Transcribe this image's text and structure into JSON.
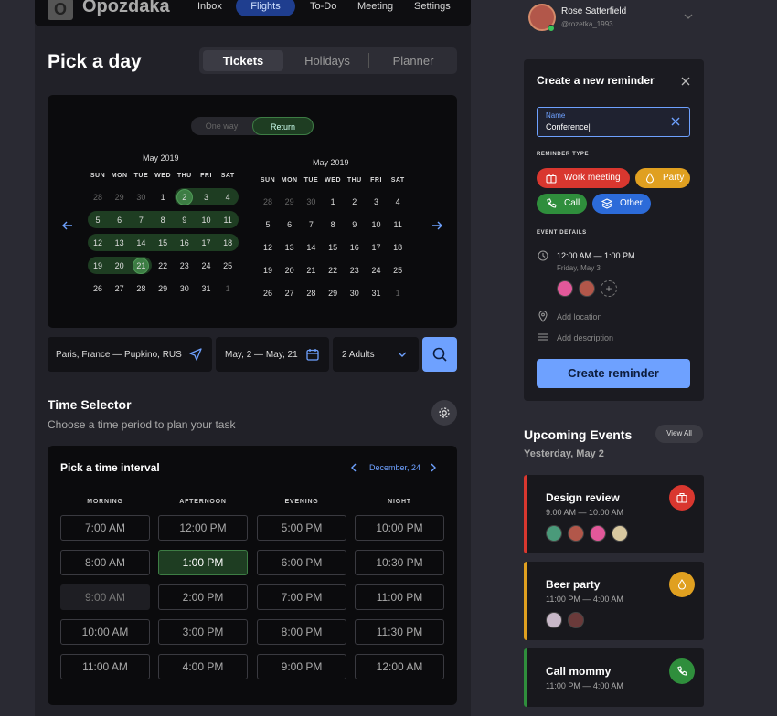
{
  "nav": {
    "logo_letter": "O",
    "logo": "Opozdaka",
    "items": [
      "Inbox",
      "Flights",
      "To-Do",
      "Meeting",
      "Settings"
    ]
  },
  "page_title": "Pick a day",
  "tabs": [
    "Tickets",
    "Holidays",
    "Planner"
  ],
  "trip_toggle": {
    "one_way": "One way",
    "return": "Return"
  },
  "calendar": {
    "left_month": "May 2019",
    "right_month": "May 2019",
    "weekdays": [
      "SUN",
      "MON",
      "TUE",
      "WED",
      "THU",
      "FRI",
      "SAT"
    ],
    "left_days": [
      [
        "28",
        "29",
        "30",
        "1",
        "2",
        "3",
        "4"
      ],
      [
        "5",
        "6",
        "7",
        "8",
        "9",
        "10",
        "11"
      ],
      [
        "12",
        "13",
        "14",
        "15",
        "16",
        "17",
        "18"
      ],
      [
        "19",
        "20",
        "21",
        "22",
        "23",
        "24",
        "25"
      ],
      [
        "26",
        "27",
        "28",
        "29",
        "30",
        "31",
        "1"
      ]
    ],
    "right_days": [
      [
        "28",
        "29",
        "30",
        "1",
        "2",
        "3",
        "4"
      ],
      [
        "5",
        "6",
        "7",
        "8",
        "9",
        "10",
        "11"
      ],
      [
        "12",
        "13",
        "14",
        "15",
        "16",
        "17",
        "18"
      ],
      [
        "19",
        "20",
        "21",
        "22",
        "23",
        "24",
        "25"
      ],
      [
        "26",
        "27",
        "28",
        "29",
        "30",
        "31",
        "1"
      ]
    ]
  },
  "search": {
    "route": "Paris, France — Pupkino, RUS",
    "dates": "May, 2 — May, 21",
    "guests": "2 Adults"
  },
  "time_selector": {
    "title": "Time Selector",
    "subtitle": "Choose a time period to plan your task",
    "panel_title": "Pick a time interval",
    "date": "December, 24",
    "columns": [
      "MORNING",
      "AFTERNOON",
      "EVENING",
      "NIGHT"
    ],
    "slots": [
      [
        "7:00 AM",
        "8:00 AM",
        "9:00 AM",
        "10:00 AM",
        "11:00 AM"
      ],
      [
        "12:00 PM",
        "1:00 PM",
        "2:00 PM",
        "3:00 PM",
        "4:00 PM"
      ],
      [
        "5:00 PM",
        "6:00 PM",
        "7:00 PM",
        "8:00 PM",
        "9:00 PM"
      ],
      [
        "10:00 PM",
        "10:30 PM",
        "11:00 PM",
        "11:30 PM",
        "12:00 AM"
      ]
    ]
  },
  "user": {
    "name": "Rose Satterfield",
    "handle": "@rozetka_1993"
  },
  "reminder": {
    "title": "Create a new reminder",
    "name_label": "Name",
    "name_value": "Conference|",
    "type_label": "REMINDER TYPE",
    "types": [
      "Work meeting",
      "Party",
      "Call",
      "Other"
    ],
    "details_label": "EVENT DETAILS",
    "time": "12:00 AM — 1:00 PM",
    "date": "Friday, May 3",
    "location": "Add location",
    "description": "Add description",
    "button": "Create reminder"
  },
  "upcoming": {
    "title": "Upcoming Events",
    "view_all": "View All",
    "date": "Yesterday, May 2",
    "events": [
      {
        "title": "Design review",
        "time": "9:00 AM — 10:00 AM"
      },
      {
        "title": "Beer party",
        "time": "11:00 PM — 4:00 AM"
      },
      {
        "title": "Call mommy",
        "time": "11:00 PM — 4:00 AM"
      }
    ]
  },
  "colors": {
    "accent": "#6ea1ff",
    "work": "#d9372f",
    "party": "#e0a020",
    "call": "#2f8e3c",
    "other": "#2c6bd9",
    "range": "#1e3d22"
  }
}
